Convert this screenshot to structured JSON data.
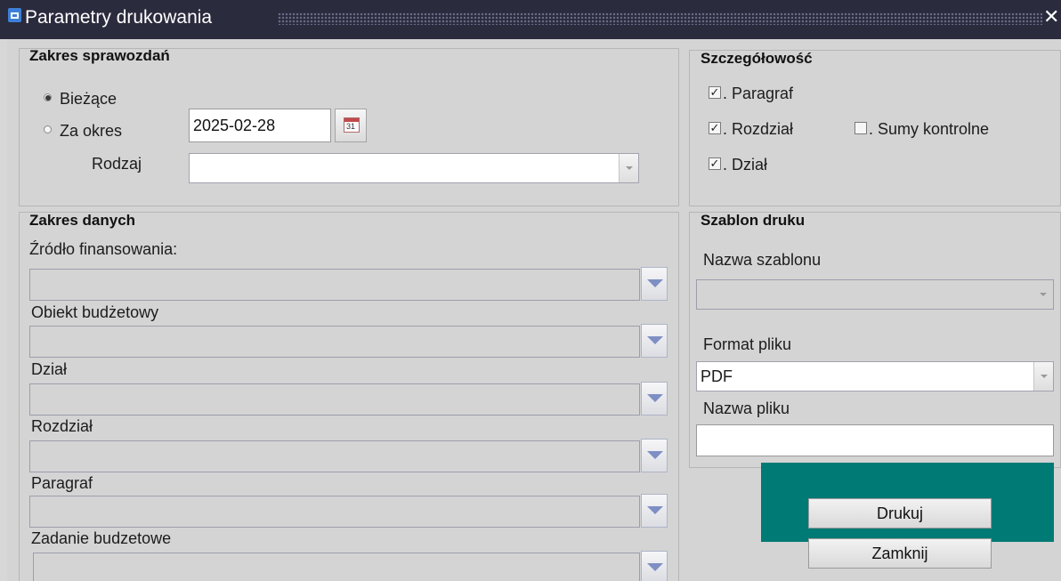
{
  "window": {
    "title": "Parametry drukowania"
  },
  "report_scope": {
    "title": "Zakres sprawozdań",
    "radio_current": {
      "label": "Bieżące",
      "selected": true
    },
    "radio_period": {
      "label": "Za okres",
      "selected": false
    },
    "date_value": "2025-02-28",
    "calendar_day": "31",
    "type_label": "Rodzaj",
    "type_value": ""
  },
  "detail": {
    "title": "Szczegółowość",
    "paragraph": {
      "label": ". Paragraf",
      "checked": true
    },
    "chapter": {
      "label": ". Rozdział",
      "checked": true
    },
    "checksums": {
      "label": ". Sumy kontrolne",
      "checked": false
    },
    "division": {
      "label": ". Dział",
      "checked": true
    }
  },
  "data_scope": {
    "title": "Zakres danych",
    "funding_label": "Źródło finansowania:",
    "object_label": "Obiekt budżetowy",
    "division_label": "Dział",
    "chapter_label": "Rozdział",
    "paragraph_label": "Paragraf",
    "task_label": "Zadanie budzetowe"
  },
  "template": {
    "title": "Szablon druku",
    "name_label": "Nazwa szablonu",
    "name_value": "",
    "format_label": "Format pliku",
    "format_value": "PDF",
    "file_label": "Nazwa pliku",
    "file_value": ""
  },
  "actions": {
    "print_label": "Drukuj",
    "close_label": "Zamknij"
  },
  "colors": {
    "title_bar": "#2b2b3e",
    "action_panel": "#007a74",
    "dropdown_arrow": "#7e8fc4"
  }
}
